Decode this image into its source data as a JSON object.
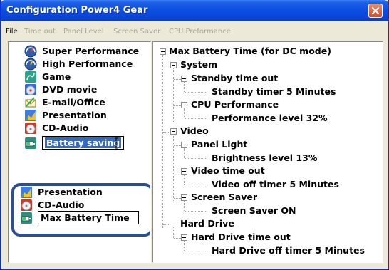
{
  "window": {
    "title": "Configuration Power4 Gear"
  },
  "menu": [
    "File",
    "Time out",
    "Panel Level",
    "Screen Saver",
    "CPU Preformance"
  ],
  "profiles_top": [
    {
      "label": "Super Performance",
      "icon": "speedometer-icon"
    },
    {
      "label": "High Performance",
      "icon": "speedometer-icon"
    },
    {
      "label": "Game",
      "icon": "game-icon"
    },
    {
      "label": "DVD movie",
      "icon": "dvd-icon"
    },
    {
      "label": "E-mail/Office",
      "icon": "email-office-icon"
    },
    {
      "label": "Presentation",
      "icon": "presentation-icon"
    },
    {
      "label": "CD-Audio",
      "icon": "cd-audio-icon"
    },
    {
      "label": "Battery saving",
      "icon": "battery-icon",
      "state": "selected-editing"
    }
  ],
  "profiles_battery": [
    {
      "label": "Presentation",
      "icon": "presentation-icon"
    },
    {
      "label": "CD-Audio",
      "icon": "cd-audio-icon"
    },
    {
      "label": "Max Battery Time",
      "icon": "battery-icon",
      "state": "editing"
    }
  ],
  "tree": {
    "root": "Max Battery Time (for DC mode)",
    "system": "System",
    "standby": "Standby time out",
    "standby_value": "Standby timer 5 Minutes",
    "cpu": "CPU Performance",
    "cpu_value": "Performance level 32%",
    "video": "Video",
    "panel": "Panel Light",
    "panel_value": "Brightness level 13%",
    "video_timeout": "Video time out",
    "video_timeout_value": "Video off timer 5 Minutes",
    "screensaver": "Screen Saver",
    "screensaver_value": "Screen Saver ON",
    "harddrive": "Hard Drive",
    "hd_timeout": "Hard Drive time out",
    "hd_timeout_value": "Hard Drive off timer 5 Minutes"
  },
  "colors": {
    "titlebar": "#0a4ee0",
    "highlight": "#316ac5",
    "group_border": "#2d4e8f",
    "close_button": "#d24b2a"
  }
}
